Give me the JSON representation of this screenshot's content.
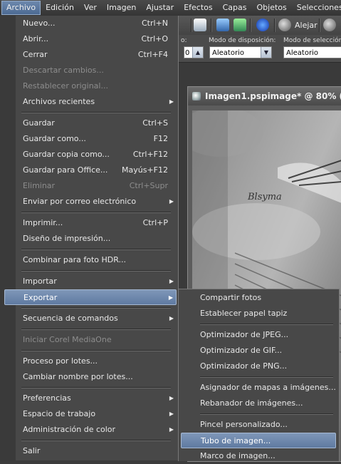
{
  "menubar": {
    "items": [
      "Archivo",
      "Edición",
      "Ver",
      "Imagen",
      "Ajustar",
      "Efectos",
      "Capas",
      "Objetos",
      "Selecciones"
    ]
  },
  "toolbar": {
    "zoom_out_label": "Alejar"
  },
  "options": {
    "spacing_value": "0",
    "placement_mode_label": "Modo de disposición:",
    "placement_mode_value": "Aleatorio",
    "selection_mode_label": "Modo de selección:",
    "selection_mode_value": "Aleatorio"
  },
  "image_window": {
    "title": "Imagen1.pspimage* @  80% (Tr",
    "watermark": "Blsyma"
  },
  "archivo_menu": {
    "items": [
      {
        "label": "Nuevo...",
        "shortcut": "Ctrl+N"
      },
      {
        "label": "Abrir...",
        "shortcut": "Ctrl+O"
      },
      {
        "label": "Cerrar",
        "shortcut": "Ctrl+F4"
      },
      {
        "label": "Descartar cambios...",
        "shortcut": ""
      },
      {
        "label": "Restablecer original...",
        "shortcut": ""
      },
      {
        "label": "Archivos recientes",
        "shortcut": ""
      },
      {
        "label": "Guardar",
        "shortcut": "Ctrl+S"
      },
      {
        "label": "Guardar como...",
        "shortcut": "F12"
      },
      {
        "label": "Guardar copia como...",
        "shortcut": "Ctrl+F12"
      },
      {
        "label": "Guardar para Office...",
        "shortcut": "Mayús+F12"
      },
      {
        "label": "Eliminar",
        "shortcut": "Ctrl+Supr"
      },
      {
        "label": "Enviar por correo electrónico",
        "shortcut": ""
      },
      {
        "label": "Imprimir...",
        "shortcut": "Ctrl+P"
      },
      {
        "label": "Diseño de impresión...",
        "shortcut": ""
      },
      {
        "label": "Combinar para foto HDR...",
        "shortcut": ""
      },
      {
        "label": "Importar",
        "shortcut": ""
      },
      {
        "label": "Exportar",
        "shortcut": ""
      },
      {
        "label": "Secuencia de comandos",
        "shortcut": ""
      },
      {
        "label": "Iniciar Corel MediaOne",
        "shortcut": ""
      },
      {
        "label": "Proceso por lotes...",
        "shortcut": ""
      },
      {
        "label": "Cambiar nombre por lotes...",
        "shortcut": ""
      },
      {
        "label": "Preferencias",
        "shortcut": ""
      },
      {
        "label": "Espacio de trabajo",
        "shortcut": ""
      },
      {
        "label": "Administración de color",
        "shortcut": ""
      },
      {
        "label": "Salir",
        "shortcut": ""
      }
    ]
  },
  "exportar_submenu": {
    "items": [
      "Compartir fotos",
      "Establecer papel tapiz",
      "Optimizador de JPEG...",
      "Optimizador de GIF...",
      "Optimizador de PNG...",
      "Asignador de mapas a imágenes...",
      "Rebanador de imágenes...",
      "Pincel personalizado...",
      "Tubo de imagen...",
      "Marco de imagen..."
    ]
  },
  "colors": {
    "highlight": "#6f89ad",
    "menu_bg": "#484848",
    "disabled_text": "#8d8d8d"
  }
}
